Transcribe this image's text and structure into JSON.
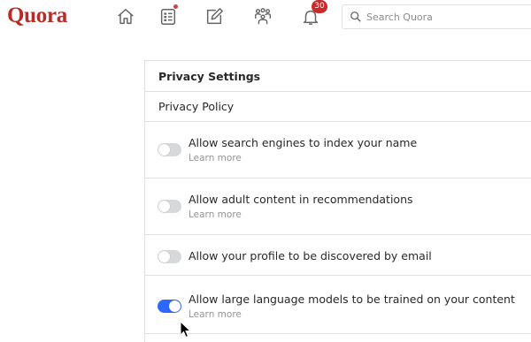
{
  "header": {
    "logo": "Quora",
    "notifications_count": "30",
    "search_placeholder": "Search Quora"
  },
  "panel": {
    "title": "Privacy Settings",
    "policy_link": "Privacy Policy",
    "settings": [
      {
        "label": "Allow search engines to index your name",
        "learn_more": "Learn more",
        "enabled": false
      },
      {
        "label": "Allow adult content in recommendations",
        "learn_more": "Learn more",
        "enabled": false
      },
      {
        "label": "Allow your profile to be discovered by email",
        "enabled": false
      },
      {
        "label": "Allow large language models to be trained on your content",
        "learn_more": "Learn more",
        "enabled": true
      }
    ]
  },
  "colors": {
    "brand": "#b92b27",
    "toggle_on": "#2e69ff",
    "toggle_off": "#d7d8d9",
    "badge": "#cb2a2a"
  },
  "icons": [
    "home-icon",
    "following-icon",
    "answer-icon",
    "spaces-icon",
    "notifications-icon",
    "search-icon",
    "mouse-cursor-icon"
  ]
}
